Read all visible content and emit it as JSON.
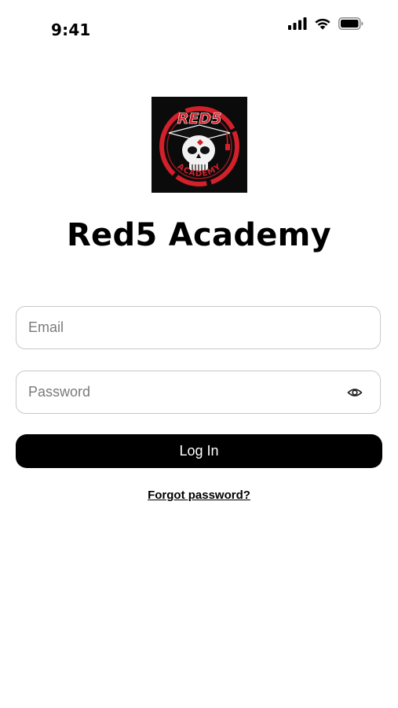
{
  "status_bar": {
    "time": "9:41",
    "icons": [
      "cellular-signal-icon",
      "wifi-icon",
      "battery-icon"
    ]
  },
  "logo": {
    "top_text": "RED5",
    "bottom_text": "ACADEMY",
    "colors": {
      "background": "#0b0b0b",
      "accent": "#d3202a",
      "skull": "#f2f2f2"
    }
  },
  "app_title": "Red5 Academy",
  "form": {
    "email": {
      "placeholder": "Email",
      "value": ""
    },
    "password": {
      "placeholder": "Password",
      "value": ""
    },
    "login_label": "Log In",
    "forgot_label": "Forgot password?"
  },
  "colors": {
    "button_bg": "#000000",
    "button_text": "#ffffff",
    "field_border": "#c8c8c8",
    "placeholder": "#7a7a7a"
  }
}
